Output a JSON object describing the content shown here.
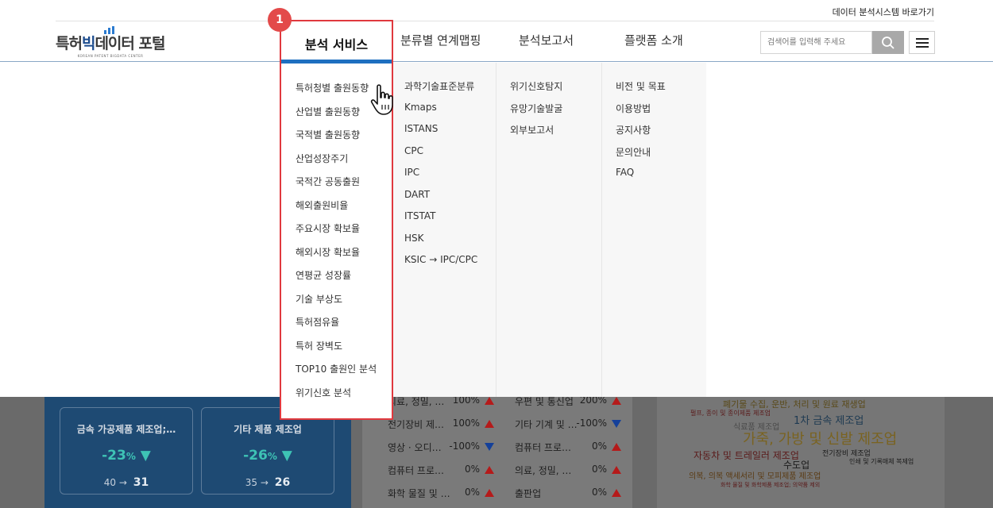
{
  "header": {
    "top_link": "데이터 분석시스템 바로가기",
    "logo_text_a": "특허",
    "logo_text_b": "빅",
    "logo_text_c": "데이터 포털",
    "logo_subtext": "KOREAN PATENT BIGDATA CENTER",
    "search_placeholder": "검색어를 입력해 주세요"
  },
  "nav": [
    "분석 서비스",
    "분류별 연계맵핑",
    "분석보고서",
    "플랫폼 소개"
  ],
  "callout": {
    "badge": "1"
  },
  "dropdown": {
    "col1": [
      "특허청별 출원동향",
      "산업별 출원동향",
      "국적별 출원동향",
      "산업성장주기",
      "국적간 공동출원",
      "해외출원비율",
      "주요시장 확보율",
      "해외시장 확보율",
      "연평균 성장률",
      "기술 부상도",
      "특허점유율",
      "특허 장벽도",
      "TOP10 출원인 분석",
      "위기신호 분석"
    ],
    "col2": [
      "과학기술표준분류",
      "Kmaps",
      "ISTANS",
      "CPC",
      "IPC",
      "DART",
      "ITSTAT",
      "HSK",
      "KSIC → IPC/CPC"
    ],
    "col3": [
      "위기신호탐지",
      "유망기술발굴",
      "외부보고서"
    ],
    "col4": [
      "비전 및 목표",
      "이용방법",
      "공지사항",
      "문의안내",
      "FAQ"
    ]
  },
  "background": {
    "cards": [
      {
        "title": "금속 가공제품 제조업;…",
        "pct": "-23",
        "unit": "%",
        "from": "40",
        "to": "31"
      },
      {
        "title": "기타 제품 제조업",
        "pct": "-26",
        "unit": "%",
        "from": "35",
        "to": "26"
      }
    ],
    "rows_left": [
      {
        "name": "의료, 정밀, …",
        "value": "100%",
        "dir": "up"
      },
      {
        "name": "전기장비 제…",
        "value": "100%",
        "dir": "up"
      },
      {
        "name": "영상 · 오디…",
        "value": "-100%",
        "dir": "down"
      },
      {
        "name": "컴퓨터 프로…",
        "value": "0%",
        "dir": "up"
      },
      {
        "name": "화학 물질 및 …",
        "value": "0%",
        "dir": "up"
      }
    ],
    "rows_right": [
      {
        "name": "우편 및 통신업",
        "value": "200%",
        "dir": "up"
      },
      {
        "name": "기타 기계 및 …",
        "value": "-100%",
        "dir": "down"
      },
      {
        "name": "컴퓨터 프로…",
        "value": "0%",
        "dir": "up"
      },
      {
        "name": "의료, 정밀, …",
        "value": "0%",
        "dir": "up"
      },
      {
        "name": "출판업",
        "value": "0%",
        "dir": "up"
      }
    ],
    "wordcloud": [
      "폐기물 수집, 운반, 처리 및 원료 재생업",
      "펄프, 종이 및 종이제품 제조업",
      "1차 금속 제조업",
      "식료품 제조업",
      "가죽, 가방 및 신발 제조업",
      "자동차 및 트레일러 제조업",
      "전기장비 제조업",
      "수도업",
      "인쇄 및 기록매체 복제업",
      "의복, 의복 액세서리 및 모피제품 제조업",
      "화학 물질 및 화학제품 제조업; 의약품 제외"
    ]
  },
  "colors": {
    "accent_blue": "#1e6fc0",
    "highlight_red": "#e0393e",
    "trend_up": "#b51a1a",
    "trend_down": "#14409a",
    "trend_pct": "#3ec3b5"
  }
}
